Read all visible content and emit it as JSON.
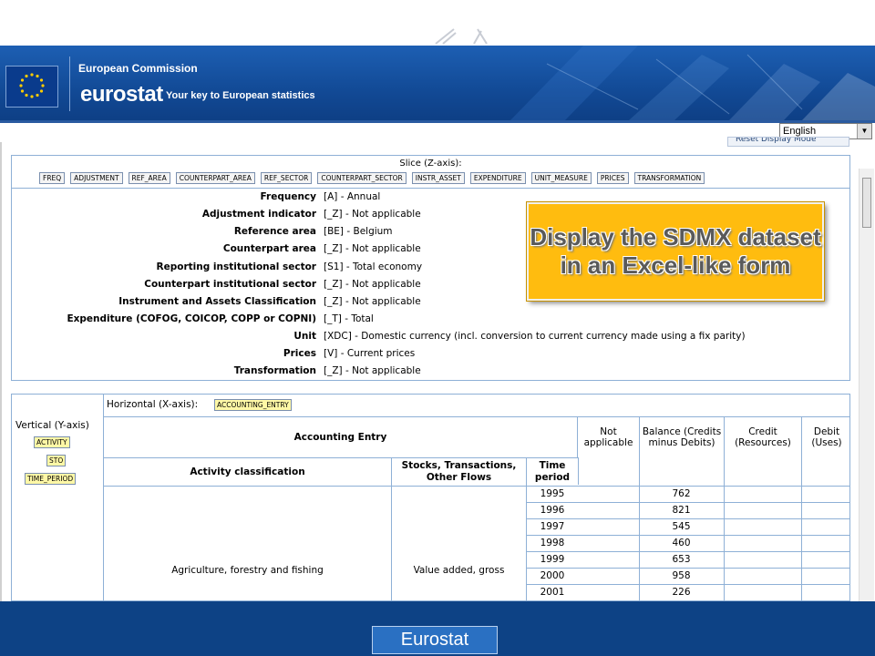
{
  "header": {
    "org": "European Commission",
    "logo": "eurostat",
    "tagline": "Your key to European statistics",
    "language": "English",
    "reset_label": "Reset Display Mode"
  },
  "slice": {
    "title": "Slice (Z-axis):",
    "chips": [
      "FREQ",
      "ADJUSTMENT",
      "REF_AREA",
      "COUNTERPART_AREA",
      "REF_SECTOR",
      "COUNTERPART_SECTOR",
      "INSTR_ASSET",
      "EXPENDITURE",
      "UNIT_MEASURE",
      "PRICES",
      "TRANSFORMATION"
    ],
    "dims": [
      {
        "label": "Frequency",
        "value": "[A] - Annual"
      },
      {
        "label": "Adjustment indicator",
        "value": "[_Z] - Not applicable"
      },
      {
        "label": "Reference area",
        "value": "[BE] - Belgium"
      },
      {
        "label": "Counterpart area",
        "value": "[_Z] - Not applicable"
      },
      {
        "label": "Reporting institutional sector",
        "value": "[S1] - Total economy"
      },
      {
        "label": "Counterpart institutional sector",
        "value": "[_Z] - Not applicable"
      },
      {
        "label": "Instrument and Assets Classification",
        "value": "[_Z] - Not applicable"
      },
      {
        "label": "Expenditure (COFOG, COICOP, COPP or COPNI)",
        "value": "[_T] - Total"
      },
      {
        "label": "Unit",
        "value": "[XDC] - Domestic currency (incl. conversion to current currency made using a fix parity)"
      },
      {
        "label": "Prices",
        "value": "[V] - Current prices"
      },
      {
        "label": "Transformation",
        "value": "[_Z] - Not applicable"
      }
    ]
  },
  "callout": "Display the SDMX dataset in an Excel-like form",
  "grid": {
    "horizontal_label": "Horizontal (X-axis):",
    "horizontal_chip": "ACCOUNTING_ENTRY",
    "vertical_label": "Vertical (Y-axis)",
    "vertical_chips": [
      "ACTIVITY",
      "STO",
      "TIME_PERIOD"
    ],
    "accounting_entry": "Accounting Entry",
    "columns": [
      "Not applicable",
      "Balance (Credits minus Debits)",
      "Credit (Resources)",
      "Debit (Uses)"
    ],
    "row_headers": [
      "Activity classification",
      "Stocks, Transactions, Other Flows",
      "Time period"
    ],
    "activity": "Agriculture, forestry and fishing",
    "sto": "Value added, gross",
    "years": [
      "1995",
      "1996",
      "1997",
      "1998",
      "1999",
      "2000",
      "2001"
    ],
    "balance": [
      "762",
      "821",
      "545",
      "460",
      "653",
      "958",
      "226"
    ]
  },
  "footer": {
    "label": "Eurostat"
  }
}
